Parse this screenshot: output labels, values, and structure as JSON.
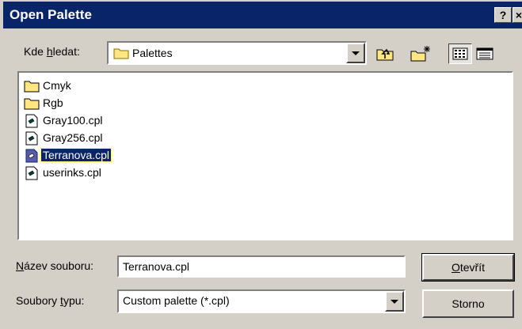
{
  "window": {
    "title": "Open Palette",
    "help_glyph": "?",
    "close_glyph": "×"
  },
  "lookin": {
    "label_pre": "Kde ",
    "label_key": "h",
    "label_post": "ledat:",
    "value": "Palettes",
    "icon": "folder-icon"
  },
  "toolbar": {
    "up_icon": "up-one-level-icon",
    "new_folder_icon": "new-folder-icon",
    "list_icon": "list-view-icon",
    "details_icon": "details-view-icon"
  },
  "files": [
    {
      "name": "Cmyk",
      "icon": "folder-icon"
    },
    {
      "name": "Rgb",
      "icon": "folder-icon"
    },
    {
      "name": "Gray100.cpl",
      "icon": "palette-file-icon"
    },
    {
      "name": "Gray256.cpl",
      "icon": "palette-file-icon"
    },
    {
      "name": "Terranova.cpl",
      "icon": "palette-file-icon",
      "selected": true
    },
    {
      "name": "userinks.cpl",
      "icon": "palette-file-icon"
    }
  ],
  "filename": {
    "label_key": "N",
    "label_post": "ázev souboru:",
    "value": "Terranova.cpl"
  },
  "filetype": {
    "label_pre": "Soubory ",
    "label_key": "t",
    "label_post": "ypu:",
    "value": "Custom palette (*.cpl)"
  },
  "buttons": {
    "open_key": "O",
    "open_post": "tevřít",
    "cancel": "Storno"
  },
  "colors": {
    "titlebar": "#0a246a",
    "face": "#d4d0c8",
    "selection": "#0a246a",
    "folder": "#ffe680"
  }
}
